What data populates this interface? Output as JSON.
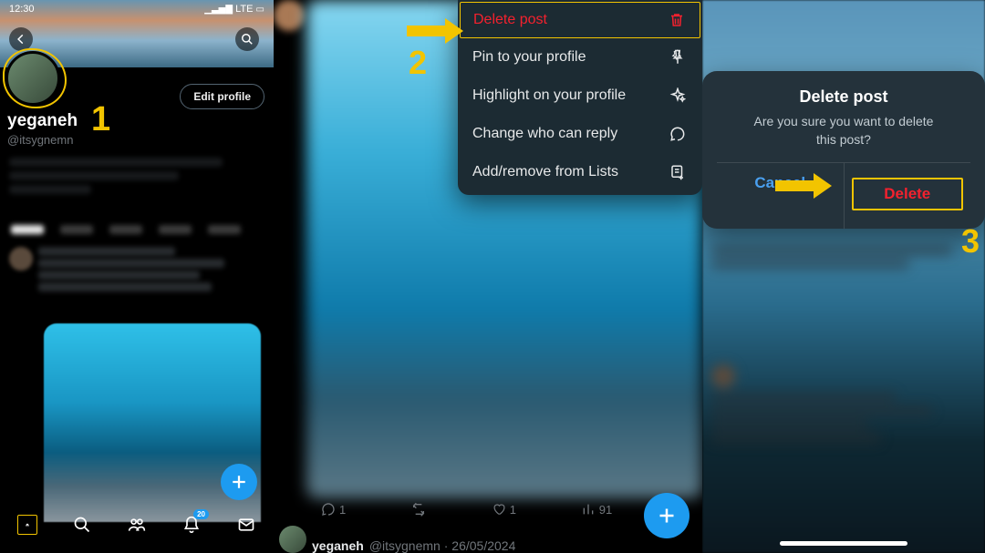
{
  "status": {
    "time": "12:30",
    "lte": "LTE"
  },
  "profile": {
    "edit_label": "Edit profile",
    "display_name": "yeganeh",
    "handle": "@itsygnemn"
  },
  "nav": {
    "notif_badge": "20"
  },
  "steps": {
    "one": "1",
    "two": "2",
    "three": "3"
  },
  "menu": {
    "delete": "Delete post",
    "pin": "Pin to your profile",
    "highlight": "Highlight on your profile",
    "reply": "Change who can reply",
    "lists": "Add/remove from Lists"
  },
  "post": {
    "replies": "1",
    "likes": "1",
    "views": "91",
    "author_name": "yeganeh",
    "author_handle": "@itsygnemn",
    "date": "26/05/2024"
  },
  "dialog": {
    "title": "Delete post",
    "body_line1": "Are you sure you want to delete",
    "body_line2": "this post?",
    "cancel": "Cancel",
    "delete": "Delete"
  }
}
